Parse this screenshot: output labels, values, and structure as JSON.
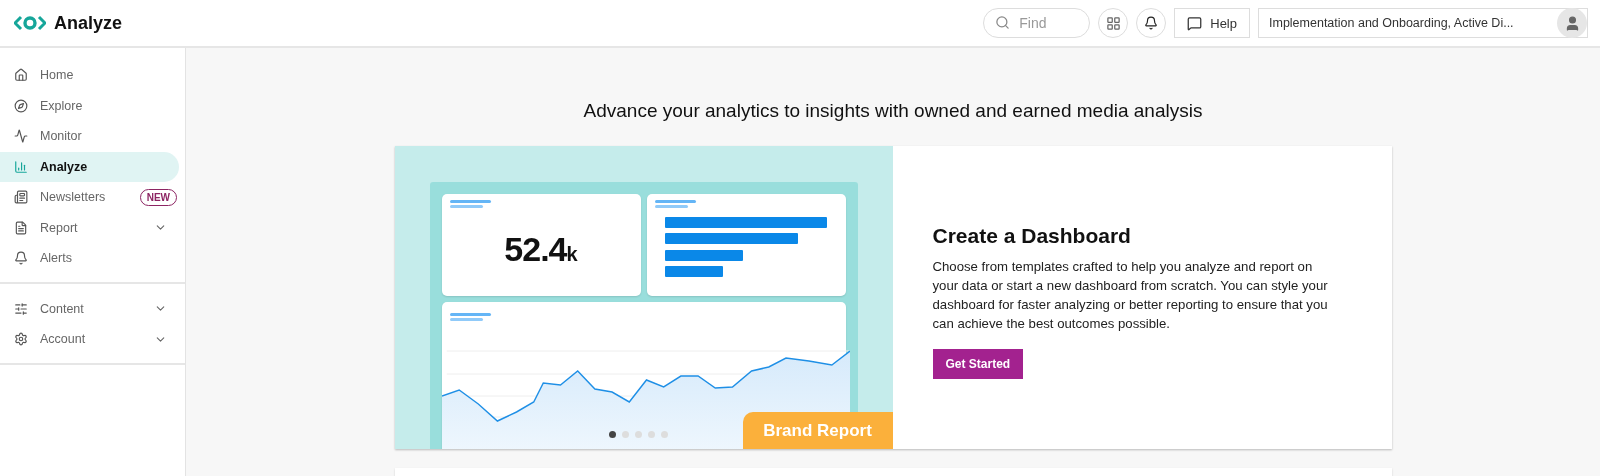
{
  "app": {
    "title": "Analyze"
  },
  "header": {
    "search": {
      "placeholder": "Find"
    },
    "help": "Help",
    "account": "Implementation and Onboarding, Active Di..."
  },
  "sidebar": {
    "groups": [
      {
        "items": [
          {
            "label": "Home",
            "selected": false,
            "expandable": false
          },
          {
            "label": "Explore",
            "selected": false,
            "expandable": false
          },
          {
            "label": "Monitor",
            "selected": false,
            "expandable": false
          },
          {
            "label": "Analyze",
            "selected": true,
            "expandable": false
          },
          {
            "label": "Newsletters",
            "selected": false,
            "expandable": false,
            "badge": "NEW"
          },
          {
            "label": "Report",
            "selected": false,
            "expandable": true
          },
          {
            "label": "Alerts",
            "selected": false,
            "expandable": false
          }
        ]
      },
      {
        "items": [
          {
            "label": "Content",
            "selected": false,
            "expandable": true
          },
          {
            "label": "Account",
            "selected": false,
            "expandable": true
          }
        ]
      }
    ]
  },
  "main": {
    "heading": "Advance your analytics to insights with owned and earned media analysis",
    "card": {
      "illustration": {
        "metric_value": "52.4",
        "metric_unit": "k",
        "tag": "Brand Report",
        "dots": [
          {
            "selected": true
          },
          {
            "selected": false
          },
          {
            "selected": false
          },
          {
            "selected": false
          },
          {
            "selected": false
          }
        ]
      },
      "title": "Create a Dashboard",
      "body": "Choose from templates crafted to help you analyze and report on your data or start a new dashboard from scratch. You can style your dashboard for faster analyzing or better reporting to ensure that you can achieve the best outcomes possible.",
      "button": "Get Started"
    }
  }
}
